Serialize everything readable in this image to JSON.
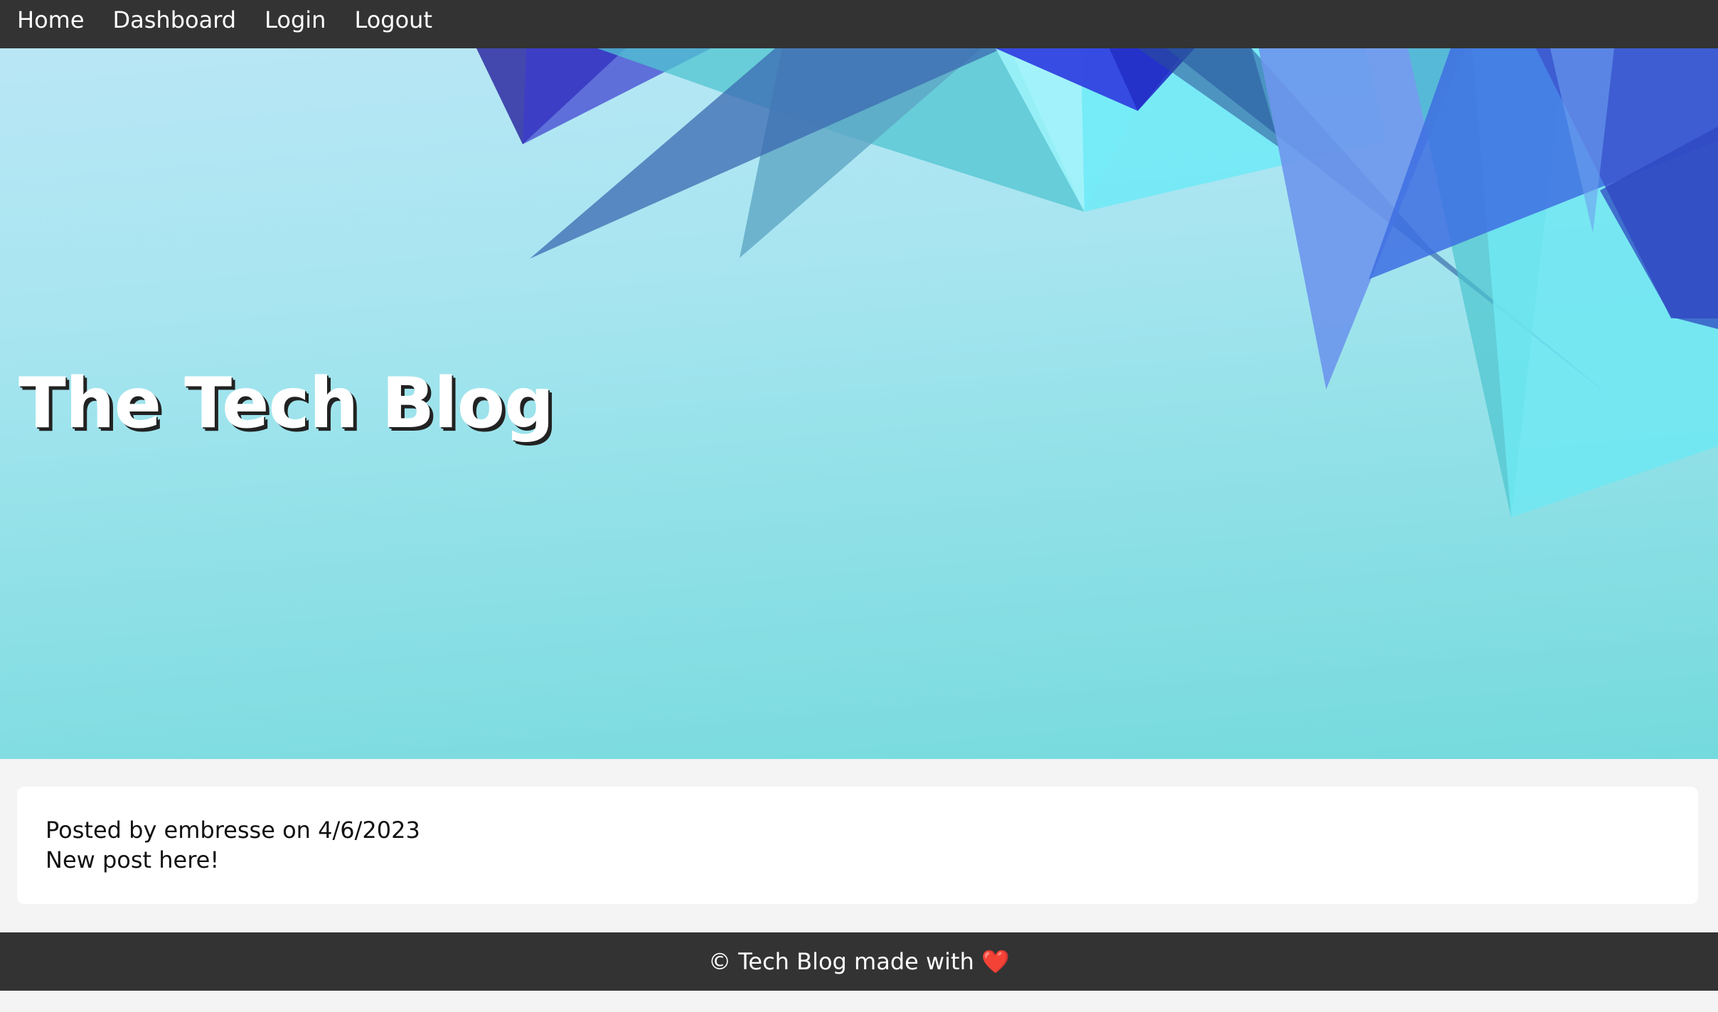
{
  "nav": {
    "items": [
      {
        "label": "Home"
      },
      {
        "label": "Dashboard"
      },
      {
        "label": "Login"
      },
      {
        "label": "Logout"
      }
    ]
  },
  "hero": {
    "title": "The Tech Blog"
  },
  "posts": [
    {
      "meta": "Posted by embresse on 4/6/2023",
      "content": "New post here!"
    }
  ],
  "footer": {
    "text": "© Tech Blog made with",
    "heart_icon": "❤️"
  },
  "colors": {
    "nav_bg": "#333333",
    "page_bg": "#f4f4f4",
    "hero_bg": "#a6e5f0",
    "accent_blue": "#3b5fd9",
    "accent_cyan": "#6fe6f5"
  }
}
